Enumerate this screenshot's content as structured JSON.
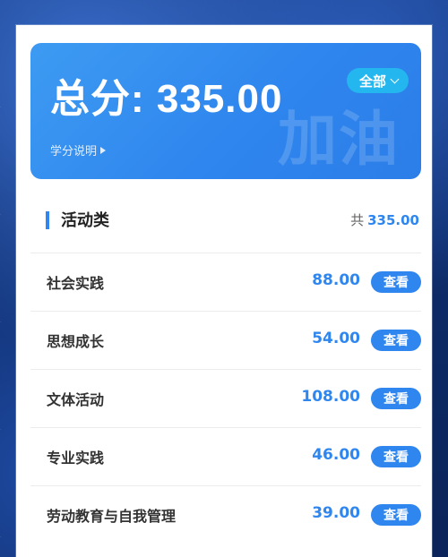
{
  "score": {
    "total_text": "总分: 335.00",
    "watermark": "加油",
    "explain_label": "学分说明",
    "filter_label": "全部"
  },
  "section": {
    "title": "活动类",
    "total_prefix": "共",
    "total_value": "335.00"
  },
  "activities": [
    {
      "label": "社会实践",
      "value": "88.00",
      "button": "查看"
    },
    {
      "label": "思想成长",
      "value": "54.00",
      "button": "查看"
    },
    {
      "label": "文体活动",
      "value": "108.00",
      "button": "查看"
    },
    {
      "label": "专业实践",
      "value": "46.00",
      "button": "查看"
    },
    {
      "label": "劳动教育与自我管理",
      "value": "39.00",
      "button": "查看"
    }
  ],
  "colors": {
    "accent": "#2f86ee",
    "filter_bg": "#23b6ef",
    "background": "#0f2c6e"
  }
}
